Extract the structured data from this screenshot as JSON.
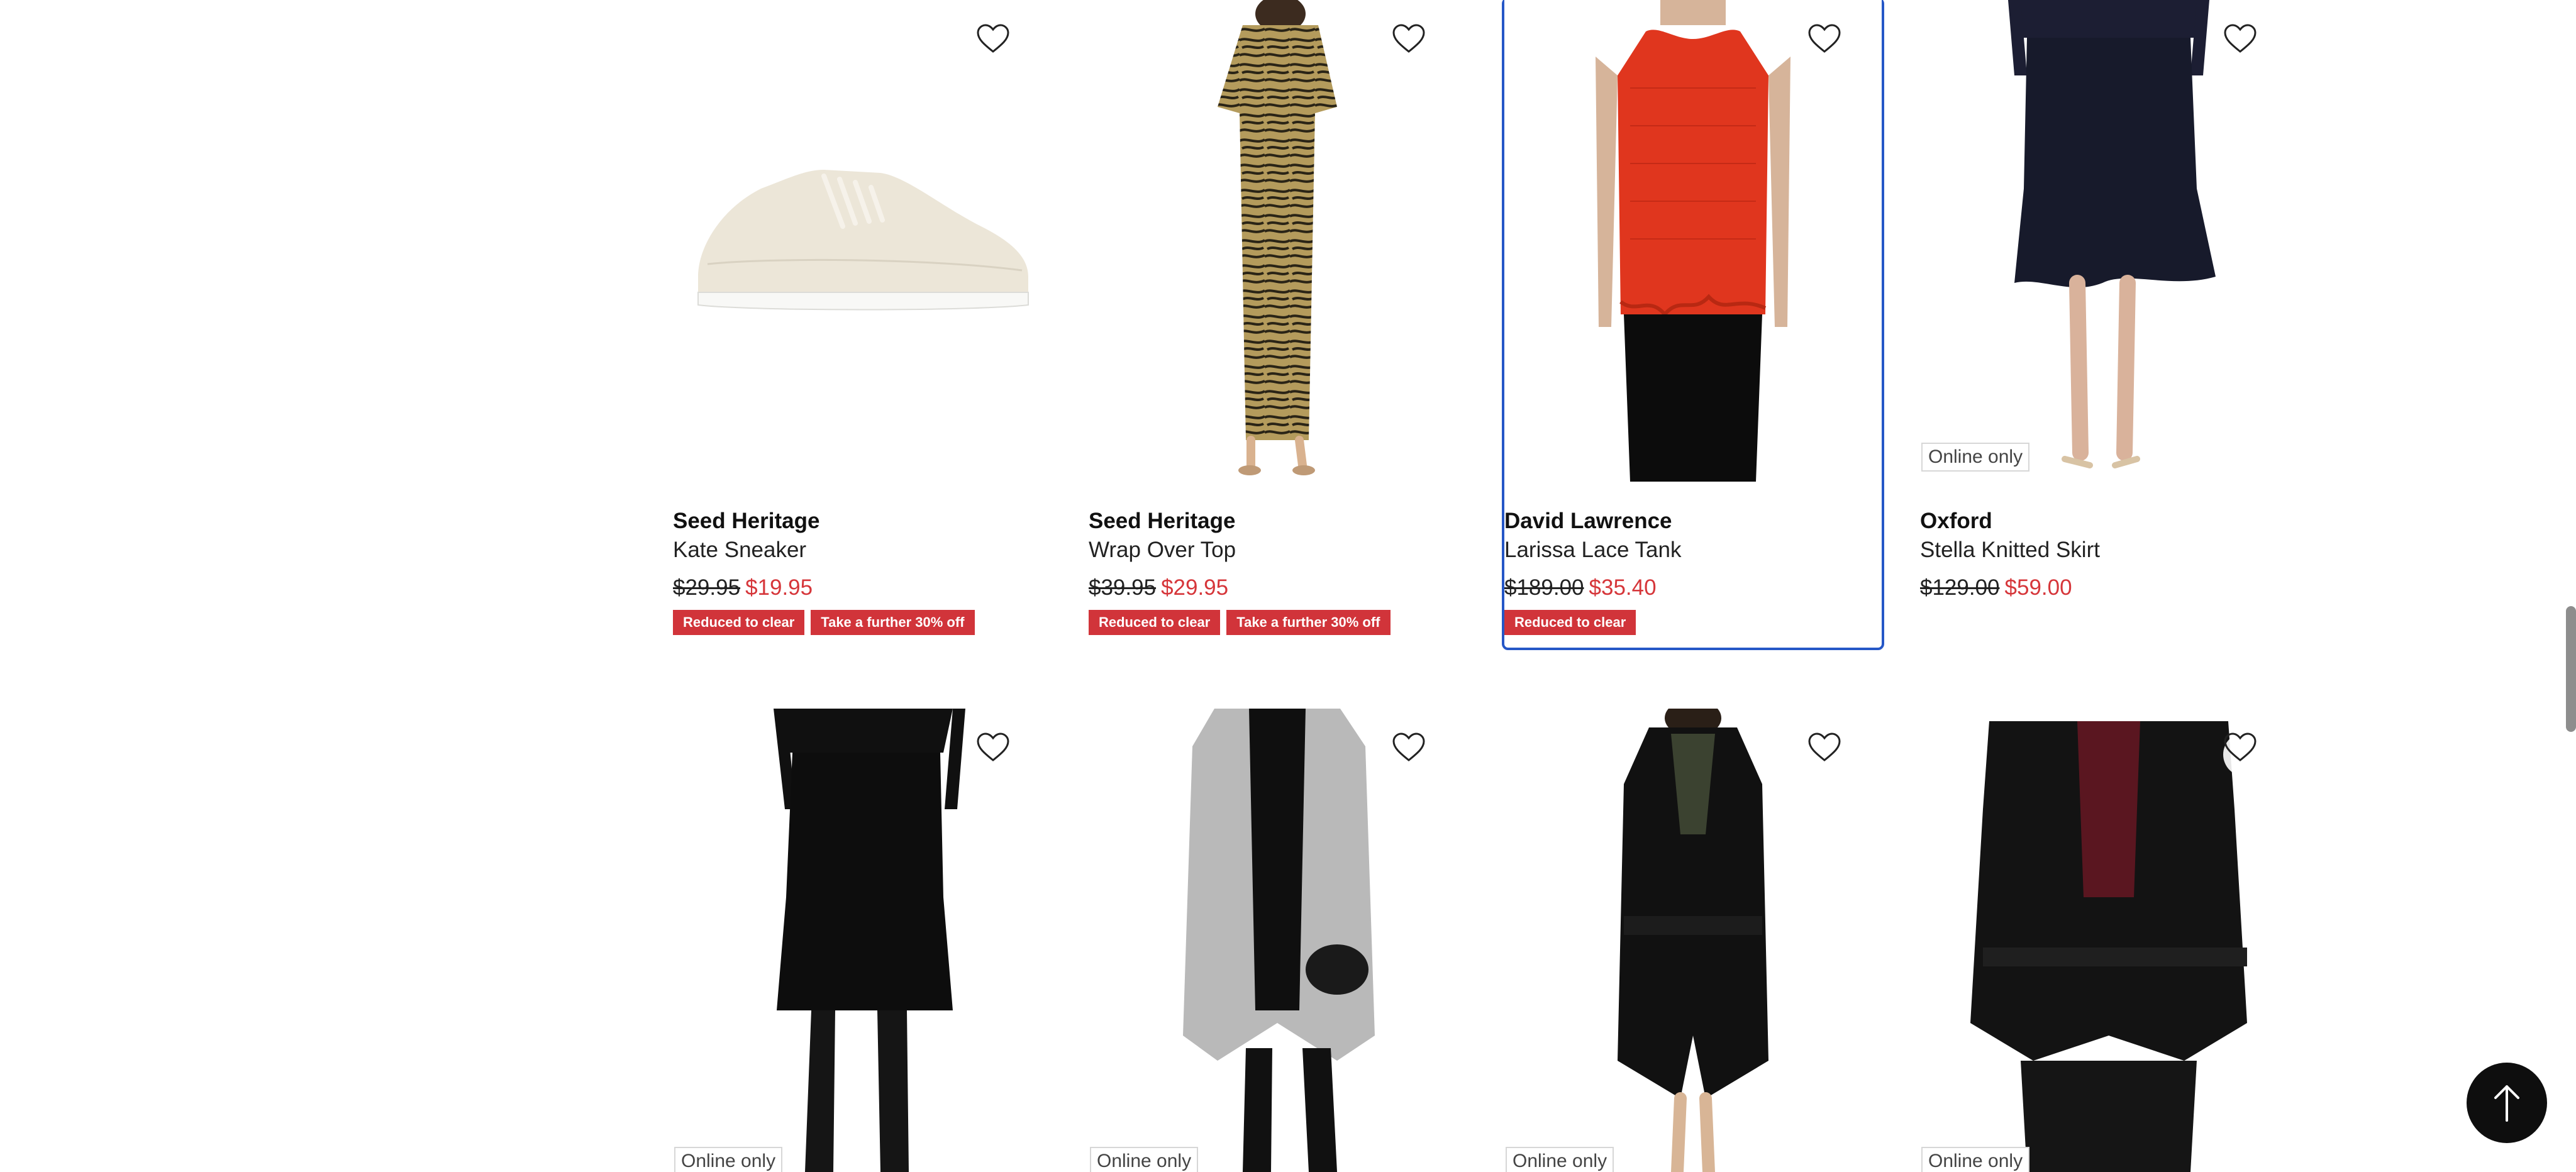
{
  "colors": {
    "sale_red": "#d1343a",
    "price_red": "#d6363a",
    "focus_blue": "#2557c7",
    "text": "#111111"
  },
  "icons": {
    "wishlist": "heart-outline-icon",
    "back_to_top": "arrow-up-icon"
  },
  "products": [
    {
      "brand": "Seed Heritage",
      "name": "Kate Sneaker",
      "was_price": "$29.95",
      "now_price": "$19.95",
      "badges": [
        "Reduced to clear",
        "Take a further 30% off"
      ],
      "online_only": ""
    },
    {
      "brand": "Seed Heritage",
      "name": "Wrap Over Top",
      "was_price": "$39.95",
      "now_price": "$29.95",
      "badges": [
        "Reduced to clear",
        "Take a further 30% off"
      ],
      "online_only": ""
    },
    {
      "brand": "David Lawrence",
      "name": "Larissa Lace Tank",
      "was_price": "$189.00",
      "now_price": "$35.40",
      "badges": [
        "Reduced to clear"
      ],
      "online_only": ""
    },
    {
      "brand": "Oxford",
      "name": "Stella Knitted Skirt",
      "was_price": "$129.00",
      "now_price": "$59.00",
      "badges": [],
      "online_only": "Online only"
    },
    {
      "online_only": "Online only"
    },
    {
      "online_only": "Online only"
    },
    {
      "online_only": "Online only"
    },
    {
      "online_only": "Online only"
    }
  ]
}
